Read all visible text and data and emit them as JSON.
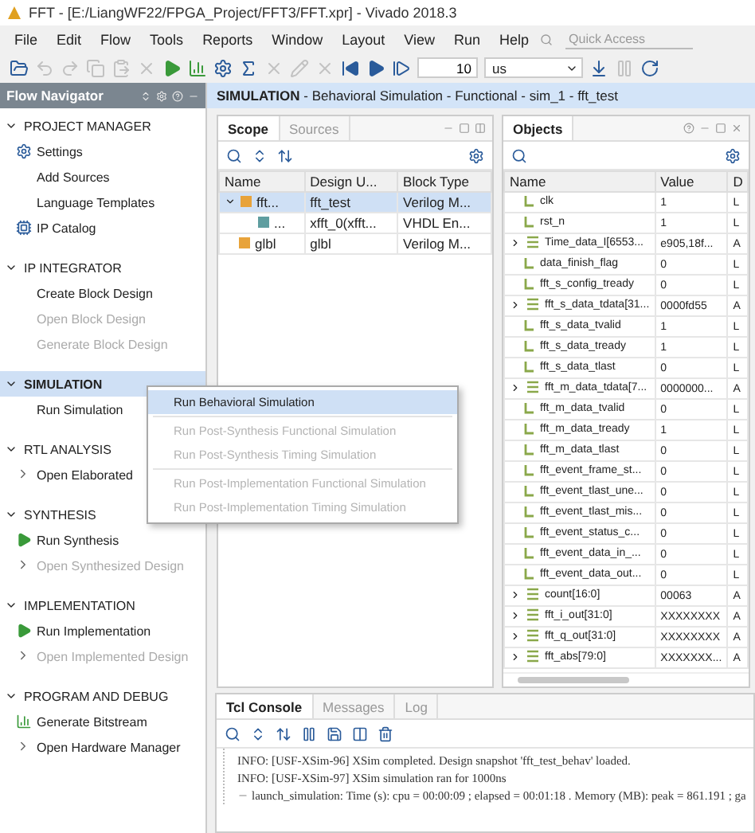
{
  "window": {
    "title": "FFT - [E:/LiangWF22/FPGA_Project/FFT3/FFT.xpr] - Vivado 2018.3"
  },
  "menu": [
    "File",
    "Edit",
    "Flow",
    "Tools",
    "Reports",
    "Window",
    "Layout",
    "View",
    "Run",
    "Help"
  ],
  "quick_access": {
    "placeholder": "Quick Access"
  },
  "toolbar": {
    "tools": [
      {
        "kind": "folder",
        "disabled": false
      },
      {
        "kind": "undo",
        "disabled": true
      },
      {
        "kind": "redo",
        "disabled": true
      },
      {
        "kind": "copy",
        "disabled": true
      },
      {
        "kind": "paste",
        "disabled": true
      },
      {
        "kind": "delete",
        "disabled": true
      },
      {
        "kind": "run",
        "disabled": false
      },
      {
        "kind": "bitstream",
        "disabled": false
      },
      {
        "kind": "gear",
        "disabled": false
      },
      {
        "kind": "sigma",
        "disabled": false
      },
      {
        "kind": "cross",
        "disabled": true
      },
      {
        "kind": "pencil",
        "disabled": true
      },
      {
        "kind": "cross",
        "disabled": true
      },
      {
        "kind": "restart",
        "disabled": false
      },
      {
        "kind": "play",
        "disabled": false
      },
      {
        "kind": "step",
        "disabled": false
      }
    ],
    "time_value": "10",
    "time_unit": "us",
    "tools_after": [
      {
        "kind": "download",
        "disabled": false
      },
      {
        "kind": "pause",
        "disabled": true
      },
      {
        "kind": "refresh",
        "disabled": false
      }
    ]
  },
  "flow_navigator": {
    "title": "Flow Navigator",
    "sections": [
      {
        "title": "PROJECT MANAGER",
        "expanded": true,
        "selected": false,
        "items": [
          {
            "label": "Settings",
            "kind": "gear",
            "disabled": false
          },
          {
            "label": "Add Sources",
            "kind": "plain",
            "disabled": false
          },
          {
            "label": "Language Templates",
            "kind": "plain",
            "disabled": false
          },
          {
            "label": "IP Catalog",
            "kind": "chip",
            "disabled": false
          }
        ]
      },
      {
        "title": "IP INTEGRATOR",
        "expanded": true,
        "selected": false,
        "items": [
          {
            "label": "Create Block Design",
            "kind": "plain",
            "disabled": false
          },
          {
            "label": "Open Block Design",
            "kind": "plain",
            "disabled": true
          },
          {
            "label": "Generate Block Design",
            "kind": "plain",
            "disabled": true
          }
        ]
      },
      {
        "title": "SIMULATION",
        "expanded": true,
        "selected": true,
        "items": [
          {
            "label": "Run Simulation",
            "kind": "plain",
            "disabled": false
          }
        ]
      },
      {
        "title": "RTL ANALYSIS",
        "expanded": true,
        "selected": false,
        "items": [
          {
            "label": "Open Elaborated",
            "kind": "expandable",
            "disabled": false
          }
        ]
      },
      {
        "title": "SYNTHESIS",
        "expanded": true,
        "selected": false,
        "items": [
          {
            "label": "Run Synthesis",
            "kind": "run",
            "disabled": false
          },
          {
            "label": "Open Synthesized Design",
            "kind": "expandable",
            "disabled": true
          }
        ]
      },
      {
        "title": "IMPLEMENTATION",
        "expanded": true,
        "selected": false,
        "items": [
          {
            "label": "Run Implementation",
            "kind": "run",
            "disabled": false
          },
          {
            "label": "Open Implemented Design",
            "kind": "expandable",
            "disabled": true
          }
        ]
      },
      {
        "title": "PROGRAM AND DEBUG",
        "expanded": true,
        "selected": false,
        "items": [
          {
            "label": "Generate Bitstream",
            "kind": "bitstream",
            "disabled": false
          },
          {
            "label": "Open Hardware Manager",
            "kind": "expandable",
            "disabled": false
          }
        ]
      }
    ]
  },
  "context_menu": [
    {
      "label": "Run Behavioral Simulation",
      "selected": true,
      "disabled": false,
      "divider_after": true
    },
    {
      "label": "Run Post-Synthesis Functional Simulation",
      "selected": false,
      "disabled": true,
      "divider_after": false
    },
    {
      "label": "Run Post-Synthesis Timing Simulation",
      "selected": false,
      "disabled": true,
      "divider_after": true
    },
    {
      "label": "Run Post-Implementation Functional Simulation",
      "selected": false,
      "disabled": true,
      "divider_after": false
    },
    {
      "label": "Run Post-Implementation Timing Simulation",
      "selected": false,
      "disabled": true,
      "divider_after": false
    }
  ],
  "simulation_header": "**SIMULATION** - Behavioral Simulation - Functional - sim_1 - fft_test",
  "scope": {
    "tabs": [
      {
        "label": "Scope",
        "selected": true
      },
      {
        "label": "Sources",
        "selected": false
      }
    ],
    "columns": [
      "Name",
      "Design U...",
      "Block Type"
    ],
    "rows": [
      {
        "name": "fft...",
        "design_unit": "fft_test",
        "block_type": "Verilog M...",
        "color": "#e8a33a",
        "selected": true,
        "expanded": true,
        "children": [
          {
            "name": "...",
            "design_unit": "xfft_0(xfft...",
            "block_type": "VHDL En...",
            "color": "#5f9ea0",
            "selected": false
          }
        ]
      },
      {
        "name": "glbl",
        "design_unit": "glbl",
        "block_type": "Verilog M...",
        "color": "#e8a33a",
        "selected": false
      }
    ]
  },
  "objects": {
    "title": "Objects",
    "columns": [
      "Name",
      "Value",
      "D"
    ],
    "rows": [
      {
        "name": "clk",
        "value": "1",
        "type": "L",
        "kind": "bit"
      },
      {
        "name": "rst_n",
        "value": "1",
        "type": "L",
        "kind": "bit"
      },
      {
        "name": "Time_data_I[6553...",
        "value": "e905,18f...",
        "type": "A",
        "kind": "bus"
      },
      {
        "name": "data_finish_flag",
        "value": "0",
        "type": "L",
        "kind": "bit"
      },
      {
        "name": "fft_s_config_tready",
        "value": "0",
        "type": "L",
        "kind": "bit"
      },
      {
        "name": "fft_s_data_tdata[31...",
        "value": "0000fd55",
        "type": "A",
        "kind": "bus"
      },
      {
        "name": "fft_s_data_tvalid",
        "value": "1",
        "type": "L",
        "kind": "bit"
      },
      {
        "name": "fft_s_data_tready",
        "value": "1",
        "type": "L",
        "kind": "bit"
      },
      {
        "name": "fft_s_data_tlast",
        "value": "0",
        "type": "L",
        "kind": "bit"
      },
      {
        "name": "fft_m_data_tdata[7...",
        "value": "0000000...",
        "type": "A",
        "kind": "bus"
      },
      {
        "name": "fft_m_data_tvalid",
        "value": "0",
        "type": "L",
        "kind": "bit"
      },
      {
        "name": "fft_m_data_tready",
        "value": "1",
        "type": "L",
        "kind": "bit"
      },
      {
        "name": "fft_m_data_tlast",
        "value": "0",
        "type": "L",
        "kind": "bit"
      },
      {
        "name": "fft_event_frame_st...",
        "value": "0",
        "type": "L",
        "kind": "bit"
      },
      {
        "name": "fft_event_tlast_une...",
        "value": "0",
        "type": "L",
        "kind": "bit"
      },
      {
        "name": "fft_event_tlast_mis...",
        "value": "0",
        "type": "L",
        "kind": "bit"
      },
      {
        "name": "fft_event_status_c...",
        "value": "0",
        "type": "L",
        "kind": "bit"
      },
      {
        "name": "fft_event_data_in_...",
        "value": "0",
        "type": "L",
        "kind": "bit"
      },
      {
        "name": "fft_event_data_out...",
        "value": "0",
        "type": "L",
        "kind": "bit"
      },
      {
        "name": "count[16:0]",
        "value": "00063",
        "type": "A",
        "kind": "bus"
      },
      {
        "name": "fft_i_out[31:0]",
        "value": "XXXXXXXX",
        "type": "A",
        "kind": "bus"
      },
      {
        "name": "fft_q_out[31:0]",
        "value": "XXXXXXXX",
        "type": "A",
        "kind": "bus"
      },
      {
        "name": "fft_abs[79:0]",
        "value": "XXXXXXX...",
        "type": "A",
        "kind": "bus"
      }
    ]
  },
  "console": {
    "tabs": [
      {
        "label": "Tcl Console",
        "selected": true
      },
      {
        "label": "Messages",
        "selected": false
      },
      {
        "label": "Log",
        "selected": false
      }
    ],
    "lines": [
      {
        "text": "INFO: [USF-XSim-96] XSim completed. Design snapshot 'fft_test_behav' loaded.",
        "collapsible": false
      },
      {
        "text": "INFO: [USF-XSim-97] XSim simulation ran for 1000ns",
        "collapsible": false
      },
      {
        "text": "launch_simulation: Time (s): cpu = 00:00:09 ; elapsed = 00:01:18 . Memory (MB): peak = 861.191 ; ga",
        "collapsible": true
      }
    ]
  }
}
